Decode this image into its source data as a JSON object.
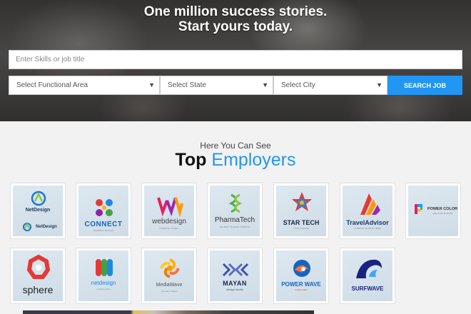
{
  "hero": {
    "title_line1": "One million success stories.",
    "title_line2": "Start yours today."
  },
  "search": {
    "placeholder": "Enter Skills or job title",
    "functional_area": "Select Functional Area",
    "state": "Select State",
    "city": "Select City",
    "button_label": "SEARCH JOB"
  },
  "section": {
    "eyebrow": "Here You Can See",
    "headline_dark": "Top",
    "headline_blue": "Employers"
  },
  "employers": [
    {
      "name": "NetDesign",
      "sub": "NetDesign"
    },
    {
      "name": "CONNECT",
      "tagline": "COMPANY SLOGAN"
    },
    {
      "name": "webdesign",
      "tagline": "CREATIVE STUDIO"
    },
    {
      "name": "PharmaTech",
      "tagline": "THE BEST PHARMA COMPANY"
    },
    {
      "name": "STAR TECH",
      "tagline": "YOUR TAGLINE"
    },
    {
      "name": "TravelAdvisor",
      "tagline": "COMPANY SLOGAN HERE"
    },
    {
      "name": "POWER COLOR",
      "tagline": "CREATIVE SLOGAN"
    },
    {
      "name": "sphere"
    },
    {
      "name": "netdesign",
      "tagline": "creative studio"
    },
    {
      "name": "MediaWave",
      "tagline": "Company Slogan"
    },
    {
      "name": "MAYAN",
      "tagline": "design studio"
    },
    {
      "name": "POWER WAVE",
      "tagline": "media studio"
    },
    {
      "name": "SURFWAVE"
    }
  ],
  "colors": {
    "accent": "#2196f3",
    "dark_text": "#111111"
  }
}
